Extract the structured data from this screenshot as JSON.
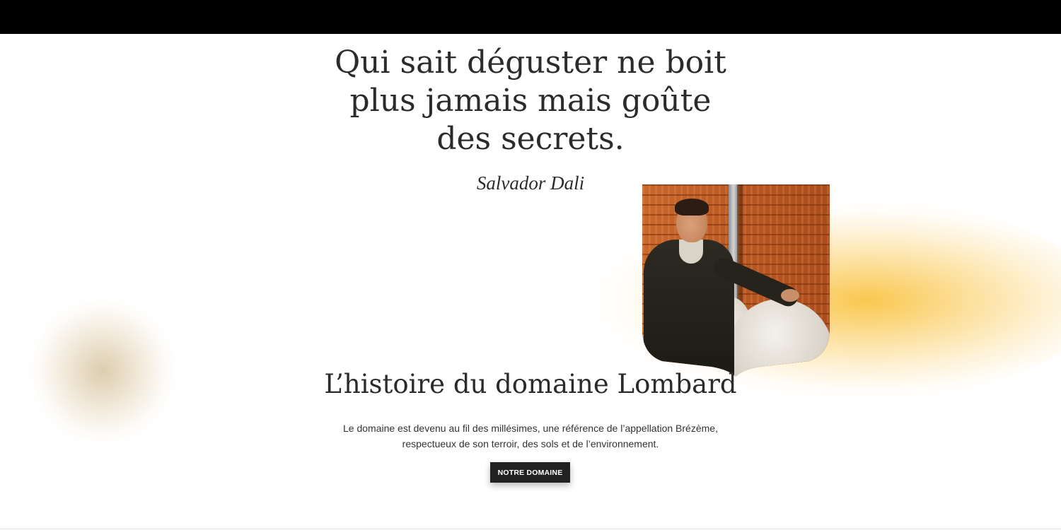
{
  "quote": {
    "lines": [
      "Qui sait déguster ne boit",
      "plus jamais mais goûte",
      "des secrets."
    ],
    "author": "Salvador Dali"
  },
  "story": {
    "heading": "L’histoire du domaine Lombard",
    "description_lines": [
      "Le domaine est devenu au fil des millésimes, une référence de l’appellation Brézème,",
      "respectueux de son terroir, des sols et de l’environnement."
    ],
    "cta_label": "NOTRE DOMAINE"
  },
  "colors": {
    "top_bar": "#000000",
    "text": "#2b2b2b",
    "button": "#222222",
    "glow_warm": "#fac446",
    "glow_neutral": "#d6c4a0"
  },
  "icons": []
}
